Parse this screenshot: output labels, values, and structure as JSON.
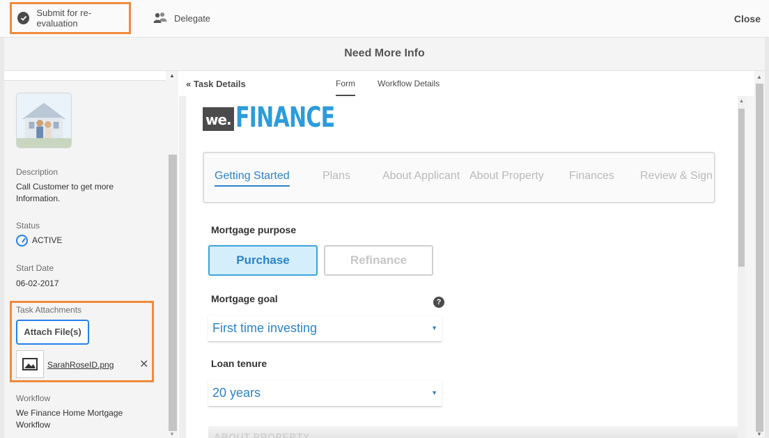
{
  "toolbar": {
    "submit_label": "Submit for re-evaluation",
    "delegate_label": "Delegate",
    "close_label": "Close",
    "highlight_color": "#f08a3c"
  },
  "title": "Need More Info",
  "task": {
    "description_label": "Description",
    "description": "Call Customer to get more Information.",
    "status_label": "Status",
    "status": "ACTIVE",
    "start_date_label": "Start Date",
    "start_date": "06-02-2017",
    "attachments_label": "Task Attachments",
    "attach_button": "Attach File(s)",
    "attachment_file": "SarahRoseID.png",
    "workflow_label": "Workflow",
    "workflow": "We Finance Home Mortgage Workflow"
  },
  "panel_tabs": {
    "back_label": "Task Details",
    "tabs": [
      "Form",
      "Workflow Details"
    ],
    "active_tab": "Form"
  },
  "form": {
    "logo_we": "we.",
    "logo_finance": "FINANCE",
    "brand_color": "#2b9cdc",
    "wizard_steps": [
      "Getting Started",
      "Plans",
      "About Applicant",
      "About Property",
      "Finances",
      "Review & Sign"
    ],
    "active_step": "Getting Started",
    "mortgage_purpose_label": "Mortgage purpose",
    "purpose_options": [
      "Purchase",
      "Refinance"
    ],
    "purpose_selected": "Purchase",
    "mortgage_goal_label": "Mortgage goal",
    "mortgage_goal_value": "First time investing",
    "help_icon": "?",
    "loan_tenure_label": "Loan tenure",
    "loan_tenure_value": "20 years",
    "next_section": "ABOUT PROPERTY"
  }
}
